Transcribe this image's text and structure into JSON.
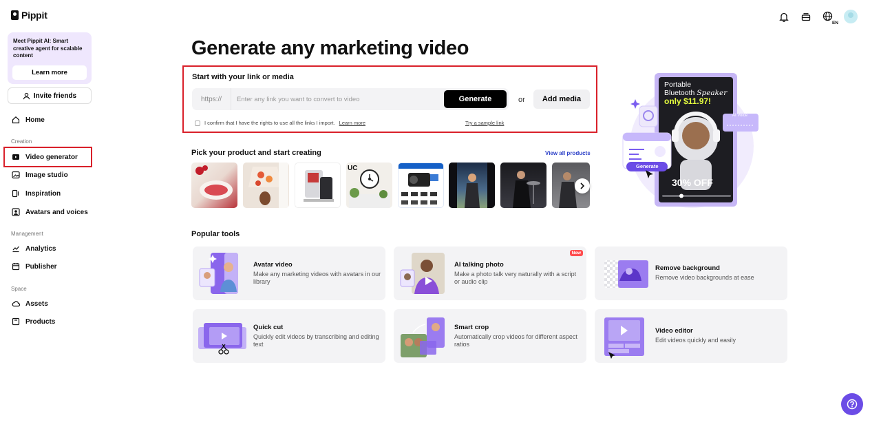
{
  "app": {
    "name": "Pippit"
  },
  "promo": {
    "text": "Meet Pippit AI: Smart creative agent for scalable content",
    "button": "Learn more"
  },
  "invite": {
    "label": "Invite friends"
  },
  "nav": {
    "home": "Home",
    "creation_section": "Creation",
    "video_generator": "Video generator",
    "image_studio": "Image studio",
    "inspiration": "Inspiration",
    "avatars_voices": "Avatars and voices",
    "management_section": "Management",
    "analytics": "Analytics",
    "publisher": "Publisher",
    "space_section": "Space",
    "assets": "Assets",
    "products": "Products"
  },
  "topbar": {
    "language": "EN"
  },
  "hero": {
    "title": "Generate any marketing video",
    "link_section_title": "Start with your link or media",
    "url_prefix": "https://",
    "url_placeholder": "Enter any link you want to convert to video",
    "url_value": "",
    "generate_button": "Generate",
    "or_text": "or",
    "add_media_button": "Add media",
    "confirm_text": "I confirm that I have the rights to use all the links I import.",
    "confirm_link": "Learn more",
    "sample_link": "Try a sample link"
  },
  "products_section": {
    "title": "Pick your product and start creating",
    "view_all": "View all products"
  },
  "hero_art": {
    "headline_1": "Portable",
    "headline_2": "Bluetooth",
    "headline_3": "Speaker",
    "price": "only $11.97!",
    "discount": "30% OFF",
    "ai_voice": "AI Voice",
    "generate_chip": "Generate"
  },
  "tools": {
    "title": "Popular tools",
    "new_badge": "New",
    "items": [
      {
        "title": "Avatar video",
        "desc": "Make any marketing videos with avatars in our library"
      },
      {
        "title": "AI talking photo",
        "desc": "Make a photo talk very naturally with a script or audio clip"
      },
      {
        "title": "Remove background",
        "desc": "Remove video backgrounds at ease"
      },
      {
        "title": "Quick cut",
        "desc": "Quickly edit videos by transcribing and editing text"
      },
      {
        "title": "Smart crop",
        "desc": "Automatically crop videos for different aspect ratios"
      },
      {
        "title": "Video editor",
        "desc": "Edit videos quickly and easily"
      }
    ]
  },
  "colors": {
    "accent": "#6b4ce6",
    "highlight": "#d9202a",
    "promo_bg": "#efe7fd",
    "card_bg": "#f3f3f5"
  }
}
